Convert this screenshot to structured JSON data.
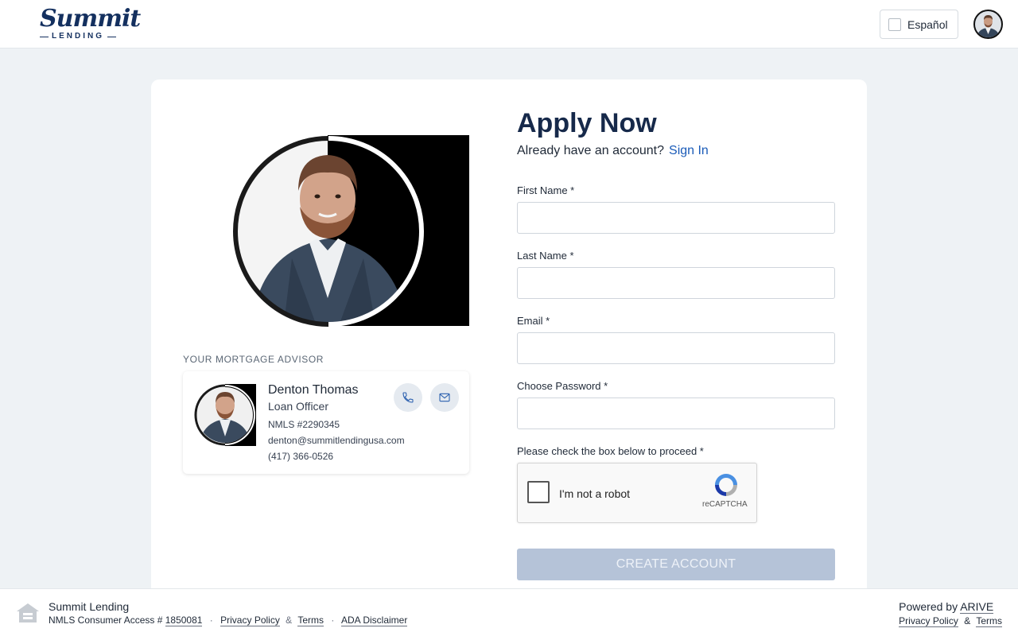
{
  "header": {
    "logo_main": "Summit",
    "logo_sub": "LENDING",
    "language_toggle_label": "Español"
  },
  "advisor": {
    "section_title": "YOUR MORTGAGE ADVISOR",
    "name": "Denton Thomas",
    "role": "Loan Officer",
    "nmls": "NMLS #2290345",
    "email": "denton@summitlendingusa.com",
    "phone": "(417) 366-0526"
  },
  "form": {
    "title": "Apply Now",
    "account_prompt": "Already have an account?",
    "sign_in_label": "Sign In",
    "fields": [
      {
        "label": "First Name *",
        "value": "",
        "placeholder": ""
      },
      {
        "label": "Last Name *",
        "value": "",
        "placeholder": ""
      },
      {
        "label": "Email *",
        "value": "",
        "placeholder": ""
      },
      {
        "label": "Choose Password *",
        "value": "",
        "placeholder": ""
      }
    ],
    "captcha_prompt": "Please check the box below to proceed *",
    "captcha_label": "I'm not a robot",
    "captcha_brand": "reCAPTCHA",
    "submit_label": "CREATE ACCOUNT"
  },
  "footer": {
    "company": "Summit Lending",
    "nmls_prefix": "NMLS Consumer Access #",
    "nmls_number": "1850081",
    "privacy_label": "Privacy Policy",
    "and": "&",
    "terms_label": "Terms",
    "ada_label": "ADA Disclaimer",
    "powered_by": "Powered by",
    "powered_brand": "ARIVE",
    "right_privacy_label": "Privacy Policy",
    "right_terms_label": "Terms"
  },
  "colors": {
    "brand_navy": "#16294a",
    "link_blue": "#1a5bb8",
    "button_disabled": "#b5c3d8",
    "page_background": "#eef2f5"
  },
  "icons": {
    "phone": "phone-icon",
    "email": "mail-icon",
    "recaptcha": "recaptcha-logo-icon",
    "equal_housing": "equal-housing-icon"
  }
}
